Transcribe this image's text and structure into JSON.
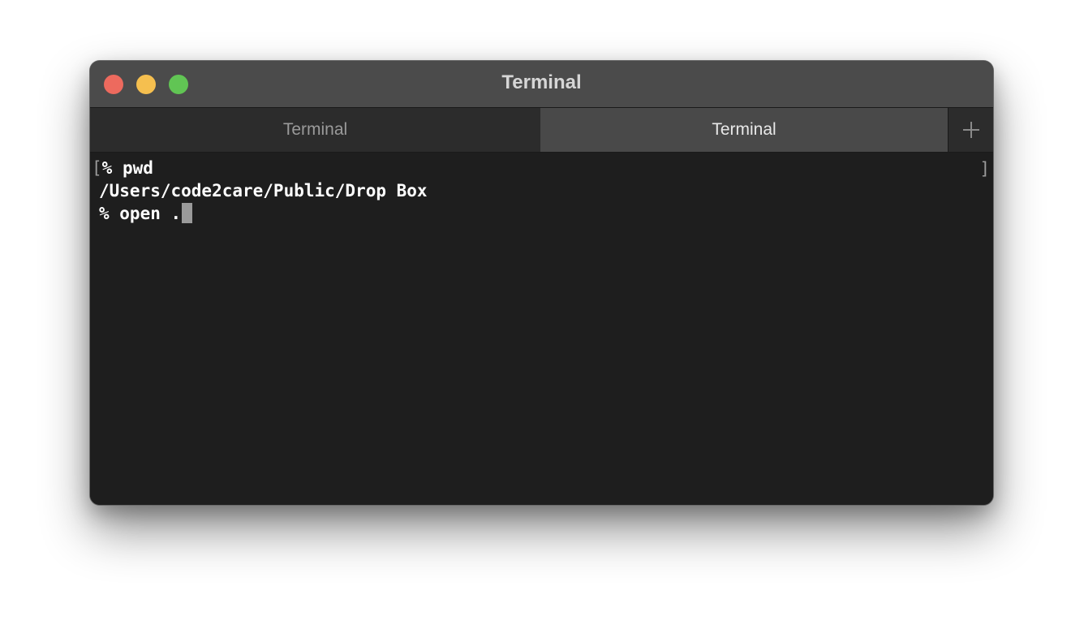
{
  "window": {
    "title": "Terminal"
  },
  "tabs": [
    {
      "label": "Terminal",
      "active": false
    },
    {
      "label": "Terminal",
      "active": true
    }
  ],
  "add_tab_icon": "plus-icon",
  "terminal": {
    "lines": [
      {
        "bracket": "[",
        "text": "% pwd"
      },
      {
        "text": "/Users/code2care/Public/Drop Box"
      },
      {
        "text": "% open ."
      }
    ],
    "right_bracket": "]"
  },
  "colors": {
    "close": "#ed6a5e",
    "minimize": "#f5bf4f",
    "zoom": "#61c554",
    "titlebar": "#4b4b4b",
    "terminal_bg": "#1e1e1e",
    "active_tab": "#494949"
  }
}
